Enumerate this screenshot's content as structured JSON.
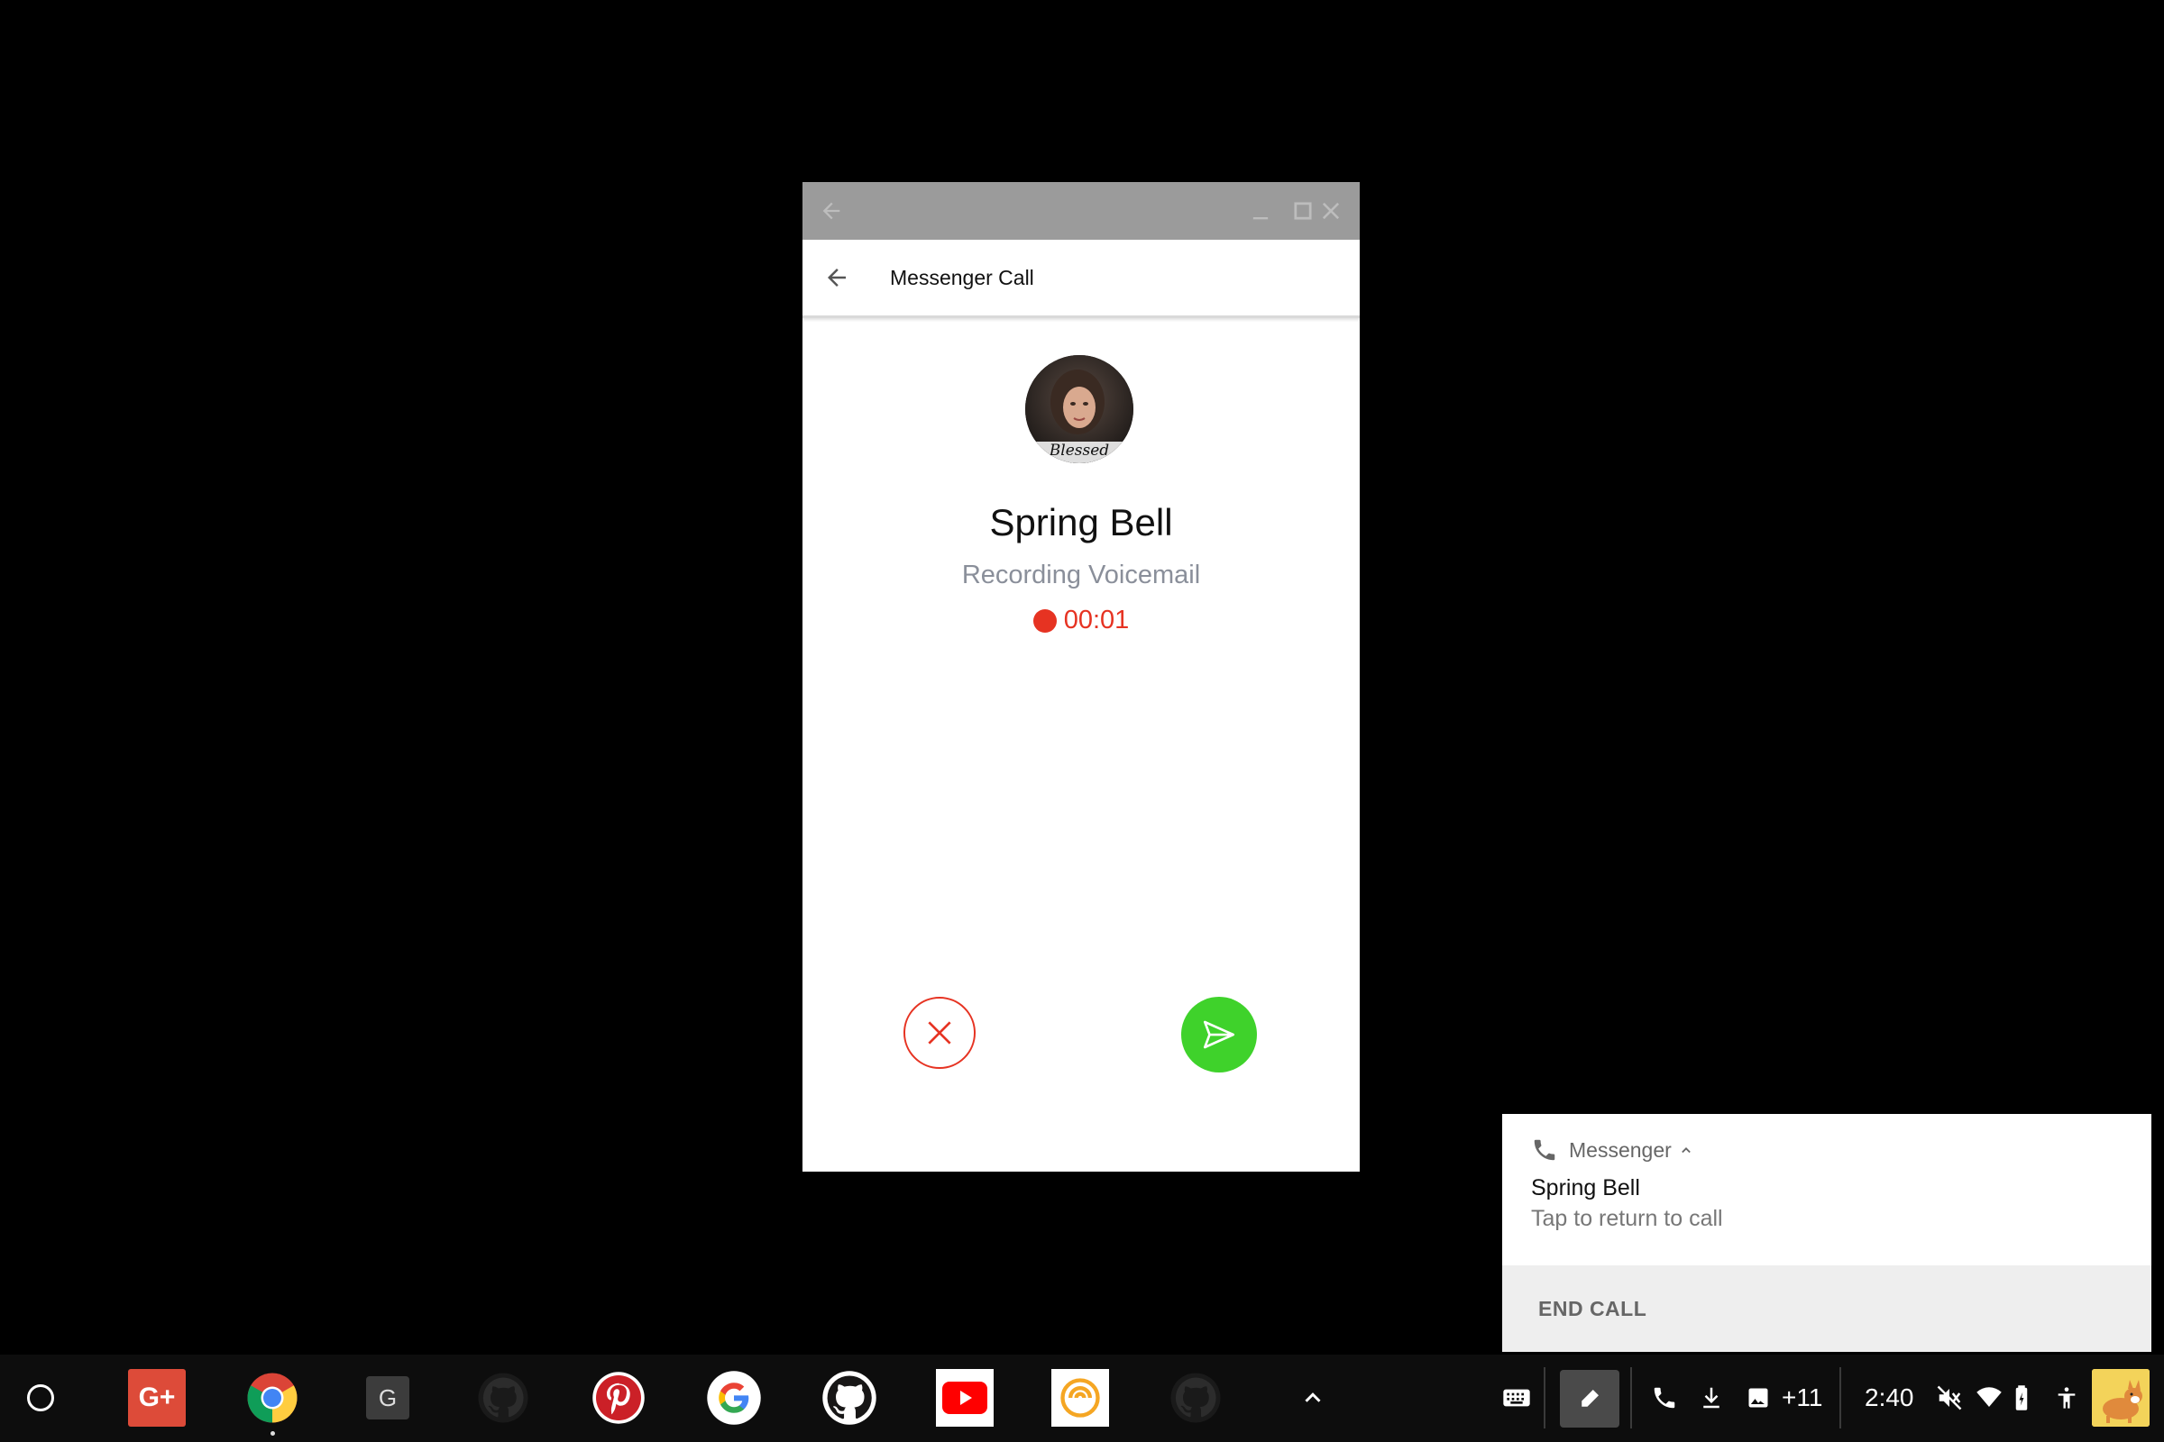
{
  "window": {
    "app_title": "Messenger Call"
  },
  "call": {
    "caller_name": "Spring Bell",
    "status": "Recording Voicemail",
    "timer": "00:01",
    "avatar_caption": "Blessed",
    "colors": {
      "record_red": "#e63322",
      "send_green": "#3fd22b"
    }
  },
  "notification": {
    "app_name": "Messenger",
    "title": "Spring Bell",
    "text": "Tap to return to call",
    "action_label": "END CALL"
  },
  "shelf": {
    "apps": [
      "Google+",
      "Chrome",
      "G",
      "GitHub",
      "Pinterest",
      "Google",
      "GitHub",
      "YouTube",
      "App",
      "GitHub"
    ],
    "google_plus_label": "G+",
    "g_label": "G",
    "tray": {
      "extra_notifications": "+11",
      "time": "2:40"
    }
  }
}
